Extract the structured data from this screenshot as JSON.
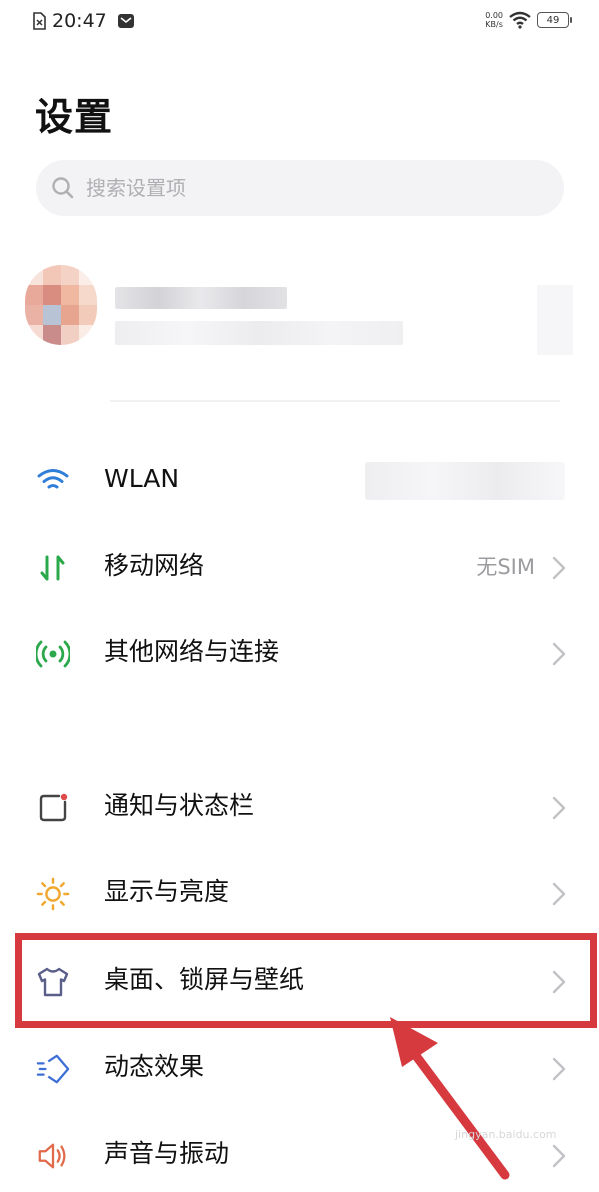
{
  "status_bar": {
    "time": "20:47",
    "net_speed_value": "0.00",
    "net_speed_unit": "KB/s",
    "battery": "49",
    "icons": [
      "no-sim-icon",
      "message-icon",
      "wifi-icon",
      "battery-icon"
    ]
  },
  "page": {
    "title": "设置"
  },
  "search": {
    "placeholder": "搜索设置项"
  },
  "sections": {
    "network": [
      {
        "id": "wlan",
        "label": "WLAN",
        "value": "",
        "icon": "wifi-icon",
        "color": "#2f7fd8"
      },
      {
        "id": "mobile-network",
        "label": "移动网络",
        "value": "无SIM",
        "icon": "mobile-data-icon",
        "color": "#2ba84a"
      },
      {
        "id": "other-networks",
        "label": "其他网络与连接",
        "value": "",
        "icon": "connection-icon",
        "color": "#2ba84a"
      }
    ],
    "device": [
      {
        "id": "notifications",
        "label": "通知与状态栏",
        "icon": "notification-icon",
        "color": "#444444"
      },
      {
        "id": "display",
        "label": "显示与亮度",
        "icon": "sun-icon",
        "color": "#f0a830"
      },
      {
        "id": "desktop",
        "label": "桌面、锁屏与壁纸",
        "icon": "tshirt-icon",
        "color": "#5a5f8a"
      },
      {
        "id": "animations",
        "label": "动态效果",
        "icon": "animation-icon",
        "color": "#3d6fd6"
      },
      {
        "id": "sound",
        "label": "声音与振动",
        "icon": "speaker-icon",
        "color": "#e06a4a"
      }
    ]
  },
  "annotation": {
    "highlight_color": "#d63a3f"
  },
  "watermark": {
    "text": "jingyan.baidu.com"
  }
}
